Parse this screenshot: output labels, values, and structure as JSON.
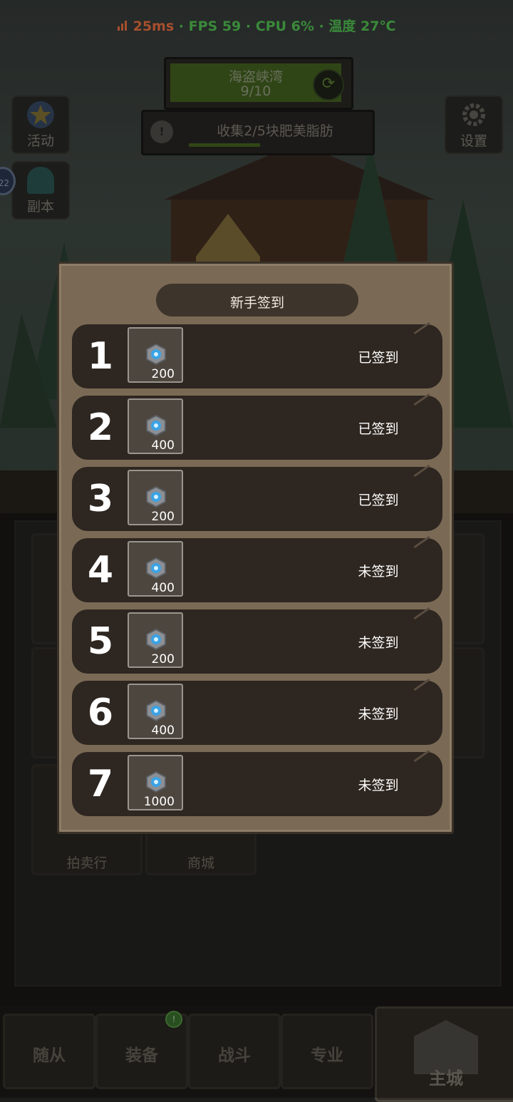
{
  "status_bar": {
    "ping": "25ms",
    "rest": " · FPS 59 · CPU 6% · 温度 27℃"
  },
  "hud": {
    "quest_title": "海盗峡湾",
    "quest_progress": "9/10",
    "task_text": "收集2/5块肥美脂肪",
    "task_badge": "!",
    "activity_label": "活动",
    "dungeon_label": "副本",
    "settings_label": "设置",
    "level_badge": "22"
  },
  "background_cards": {
    "auction_label": "拍卖行",
    "shop_label": "商城"
  },
  "modal": {
    "title": "新手签到",
    "rows": [
      {
        "day": "1",
        "qty": "200",
        "state": "已签到"
      },
      {
        "day": "2",
        "qty": "400",
        "state": "已签到"
      },
      {
        "day": "3",
        "qty": "200",
        "state": "已签到"
      },
      {
        "day": "4",
        "qty": "400",
        "state": "未签到"
      },
      {
        "day": "5",
        "qty": "200",
        "state": "未签到"
      },
      {
        "day": "6",
        "qty": "400",
        "state": "未签到"
      },
      {
        "day": "7",
        "qty": "1000",
        "state": "未签到"
      }
    ]
  },
  "bottom_nav": {
    "tabs": [
      "随从",
      "装备",
      "战斗",
      "专业"
    ],
    "home": "主城",
    "equip_badge": "!"
  },
  "colors": {
    "modal_bg": "#7a6a55",
    "row_bg": "#2e2620",
    "gem": "#3aa3e6",
    "ping": "#ff7a45",
    "fps": "#5ad35a"
  }
}
